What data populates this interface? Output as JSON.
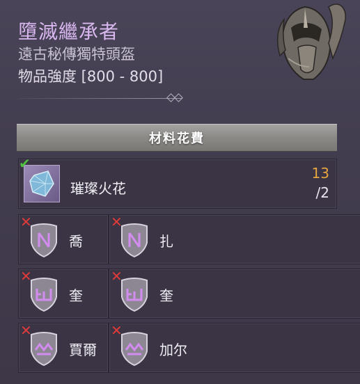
{
  "item": {
    "name": "墮滅繼承者",
    "type": "遠古秘傳獨特頭盔",
    "power": "物品強度 [800 - 800]",
    "icon": "helmet-icon"
  },
  "cost": {
    "header": "材料花費",
    "material": {
      "name": "璀璨火花",
      "owned": "13",
      "required": "/2",
      "icon": "gem-icon",
      "status": "check-icon"
    },
    "runes": [
      {
        "name": "喬",
        "icon": "rune-icon",
        "status": "x-icon"
      },
      {
        "name": "扎",
        "icon": "rune-icon",
        "status": "x-icon"
      },
      {
        "name": "奎",
        "icon": "rune-icon",
        "status": "x-icon"
      },
      {
        "name": "奎",
        "icon": "rune-icon",
        "status": "x-icon"
      },
      {
        "name": "賈爾",
        "icon": "rune-icon",
        "status": "x-icon"
      },
      {
        "name": "加尔",
        "icon": "rune-icon",
        "status": "x-icon"
      }
    ]
  },
  "colors": {
    "title": "#d9b8f0",
    "owned_count": "#e6a640",
    "missing_mark": "#e03a3a",
    "ok_mark": "#4fc040"
  }
}
